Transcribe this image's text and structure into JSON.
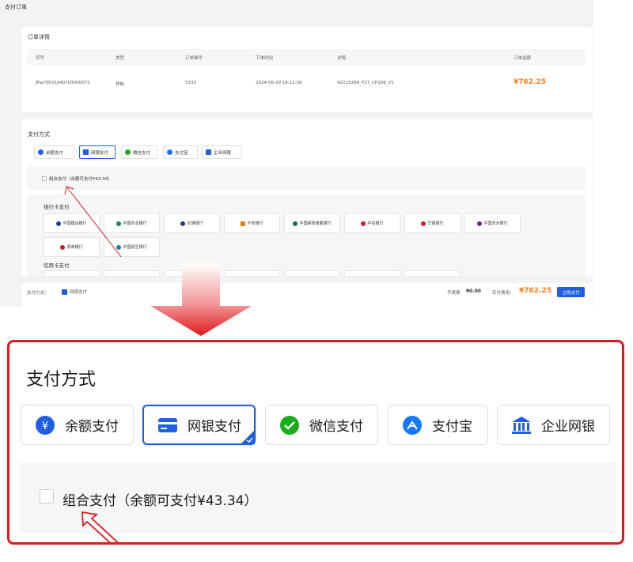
{
  "page_title": "支付订单",
  "order": {
    "title": "订单详情",
    "headers": [
      "序号",
      "类型",
      "订单编号",
      "下单时间",
      "详情",
      "订单金额"
    ],
    "row": {
      "serial": "JPayTJP20240703000072",
      "type": "样板",
      "order_no": "Y233",
      "time": "2024-06-29 16:12:30",
      "detail": "4221528A_P27_CP208_V1",
      "amount": "¥762.25"
    }
  },
  "payment": {
    "title": "支付方式",
    "methods": [
      {
        "label": "余额支付",
        "icon": "yuan-icon",
        "color": "#1f5fe0"
      },
      {
        "label": "网银支付",
        "icon": "card-icon",
        "color": "#1f5fe0",
        "selected": true
      },
      {
        "label": "微信支付",
        "icon": "wechat-icon",
        "color": "#1aad19"
      },
      {
        "label": "支付宝",
        "icon": "alipay-icon",
        "color": "#1677ff"
      },
      {
        "label": "企业网银",
        "icon": "bank-icon",
        "color": "#1f5fe0"
      }
    ],
    "combo_label": "组合支付（余额可支付¥43.34）",
    "debit_title": "银行卡支付",
    "credit_title": "信用卡支付",
    "banks": [
      {
        "name": "中国建设银行",
        "color": "#0a4aa3"
      },
      {
        "name": "中国农业银行",
        "color": "#0b8a6a"
      },
      {
        "name": "交通银行",
        "color": "#1a3b8a"
      },
      {
        "name": "平安银行",
        "color": "#f07a1a"
      },
      {
        "name": "中国邮政储蓄银行",
        "color": "#0d7a3c"
      },
      {
        "name": "中信银行",
        "color": "#d0202a"
      },
      {
        "name": "华夏银行",
        "color": "#d0202a"
      },
      {
        "name": "中国光大银行",
        "color": "#6a2c8a"
      },
      {
        "name": "浙商银行",
        "color": "#c0202a"
      },
      {
        "name": "中国民生银行",
        "color": "#1a7ab0"
      }
    ]
  },
  "summary": {
    "method_label": "支付方式：",
    "method_value": "网银支付",
    "fee_label": "手续费",
    "fee_value": "¥0.00",
    "actual_label": "实付费用：",
    "actual_value": "¥762.25",
    "pay_button": "立即支付"
  },
  "colors": {
    "accent": "#1f5fe0",
    "price": "#ff7a1a",
    "highlight_border": "#e0191e"
  }
}
